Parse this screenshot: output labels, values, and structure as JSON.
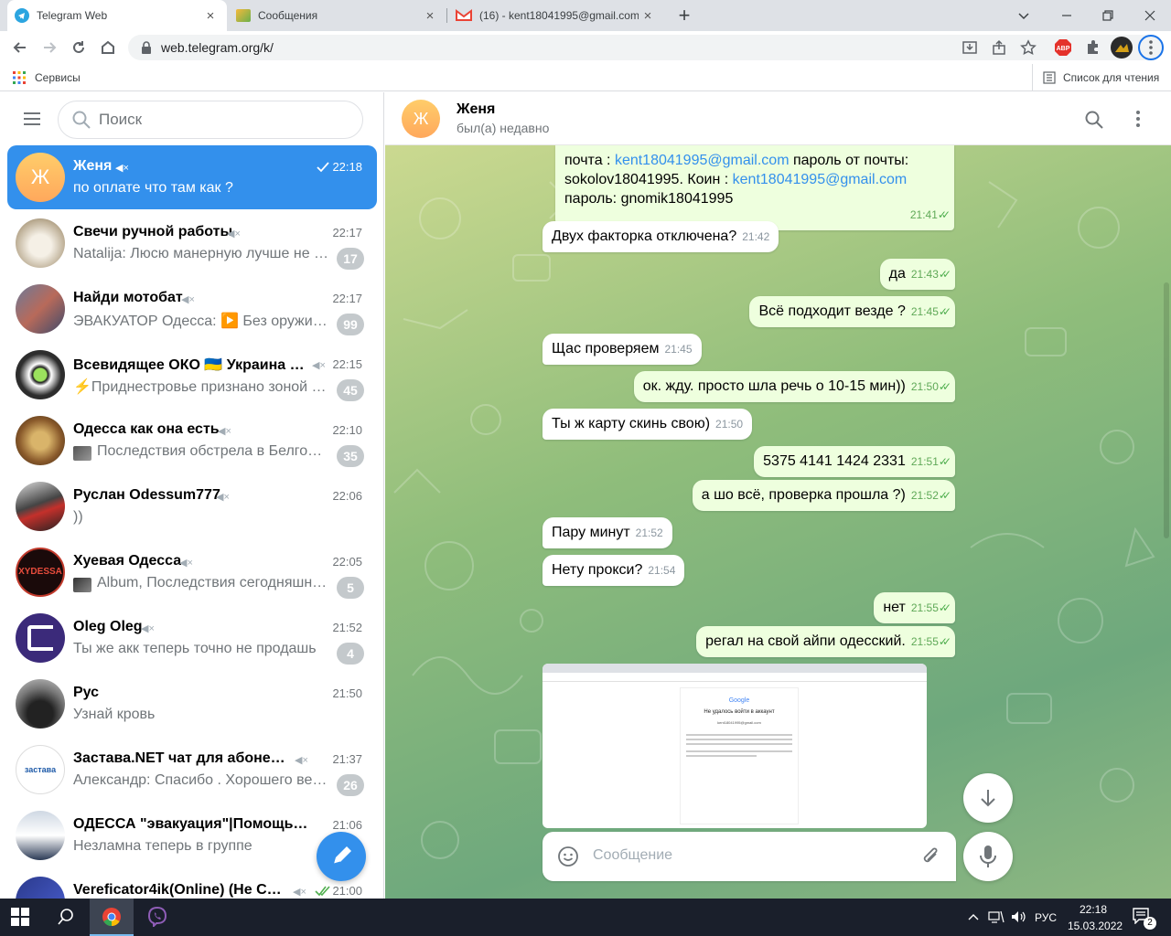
{
  "browser": {
    "tabs": [
      {
        "title": "Telegram Web",
        "close": "×",
        "active": true
      },
      {
        "title": "Сообщения",
        "close": "×",
        "active": false
      },
      {
        "title": "(16) - kent18041995@gmail.com",
        "close": "×",
        "active": false
      }
    ],
    "new_tab": "+",
    "url": "web.telegram.org/k/",
    "bookmarks": {
      "apps_label": "Сервисы",
      "reading_list": "Список для чтения"
    }
  },
  "sidebar": {
    "search_placeholder": "Поиск",
    "chats": [
      {
        "name": "Женя",
        "avatar_letter": "Ж",
        "time": "22:18",
        "preview": "по оплате что там как ?",
        "selected": true,
        "muted": true,
        "read": true
      },
      {
        "name": "Свечи ручной работы",
        "time": "22:17",
        "preview": "Natalija: Люсю манерную лучше не …",
        "badge": "17",
        "muted": true
      },
      {
        "name": "Найди мотобат",
        "time": "22:17",
        "preview": "ЭВАКУАТОР Одесса: ▶️ Без оружи…",
        "badge": "99",
        "muted": true
      },
      {
        "name": "Всевидящее ОКО 🇺🇦 Украина во…",
        "time": "22:15",
        "preview": "⚡Приднестровье признано зоной …",
        "badge": "45",
        "muted": true
      },
      {
        "name": "Одесса как она есть",
        "time": "22:10",
        "preview": "Последствия обстрела в Белго…",
        "badge": "35",
        "muted": true
      },
      {
        "name": "Руслан Odessum777",
        "time": "22:06",
        "preview": "))",
        "muted": true
      },
      {
        "name": "Хуевая Одесса",
        "time": "22:05",
        "preview": "Album, Последствия сегодняшне…",
        "badge": "5",
        "muted": true
      },
      {
        "name": "Oleg Oleg",
        "time": "21:52",
        "preview": "Ты же акк теперь точно не продашь",
        "badge": "4",
        "muted": true
      },
      {
        "name": "Рус",
        "time": "21:50",
        "preview": "Узнай кровь",
        "muted": false
      },
      {
        "name": "Застава.NET чат для абонентов",
        "time": "21:37",
        "preview": "Александр: Спасибо . Хорошего ве…",
        "badge": "26",
        "muted": true
      },
      {
        "name": "ОДЕССА \"эвакуация\"|Помощь бе…",
        "time": "21:06",
        "preview": "Незламна теперь в группе",
        "muted": true
      },
      {
        "name": "Vereficator4ik(Online) (Не Спа…",
        "time": "21:00",
        "preview": "",
        "muted": true
      }
    ]
  },
  "chat": {
    "name": "Женя",
    "avatar_letter": "Ж",
    "status": "был(а) недавно",
    "input_placeholder": "Сообщение",
    "messages": [
      {
        "dir": "out",
        "time": "21:41",
        "parts": [
          {
            "t": "почта : "
          },
          {
            "t": "kent18041995@gmail.com",
            "link": true
          },
          {
            "t": " пароль от почты: sokolov18041995. Коин : "
          },
          {
            "t": "kent18041995@gmail.com",
            "link": true
          },
          {
            "t": " пароль: gnomik18041995"
          }
        ]
      },
      {
        "dir": "in",
        "time": "21:42",
        "text": "Двух факторка отключена?"
      },
      {
        "dir": "out",
        "time": "21:43",
        "text": "да"
      },
      {
        "dir": "out",
        "time": "21:45",
        "text": "Всё подходит везде ?"
      },
      {
        "dir": "in",
        "time": "21:45",
        "text": "Щас проверяем"
      },
      {
        "dir": "out",
        "time": "21:50",
        "text": "ок. жду. просто шла речь о 10-15 мин))"
      },
      {
        "dir": "in",
        "time": "21:50",
        "text": "Ты ж карту скинь свою)"
      },
      {
        "dir": "out",
        "time": "21:51",
        "text": "5375 4141 1424 2331"
      },
      {
        "dir": "out",
        "time": "21:52",
        "text": "а шо всё, проверка прошла ?)"
      },
      {
        "dir": "in",
        "time": "21:52",
        "text": "Пару минут"
      },
      {
        "dir": "in",
        "time": "21:54",
        "text": "Нету прокси?"
      },
      {
        "dir": "out",
        "time": "21:55",
        "text": "нет"
      },
      {
        "dir": "out",
        "time": "21:55",
        "text": "регал на свой айпи одесский."
      }
    ],
    "screenshot": {
      "brand": "Google",
      "heading": "Не удалось войти в аккаунт",
      "email": "kent18041995@gmail.com"
    }
  },
  "taskbar": {
    "time": "22:18",
    "date": "15.03.2022",
    "lang": "РУС",
    "notification_count": "2"
  },
  "colors": {
    "accent": "#3390ec",
    "out_bubble": "#eeffde",
    "badge_gray": "#c4c9cc"
  }
}
